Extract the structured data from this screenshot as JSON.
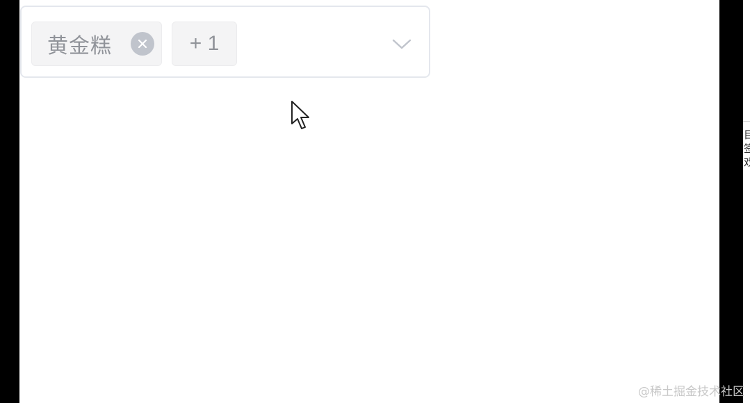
{
  "select": {
    "tags": [
      {
        "label": "黄金糕"
      },
      {
        "label": "+ 1"
      }
    ],
    "icons": {
      "close": "close-icon",
      "arrow": "chevron-down-icon"
    }
  },
  "side_fragments": [
    "目",
    "签",
    "戏"
  ],
  "watermark": "@稀土掘金技术社区",
  "colors": {
    "border": "#e4e7ed",
    "tag_bg": "#f4f4f5",
    "tag_text": "#909399",
    "close_bg": "#c0c4cc",
    "arrow": "#c0c4cc"
  }
}
